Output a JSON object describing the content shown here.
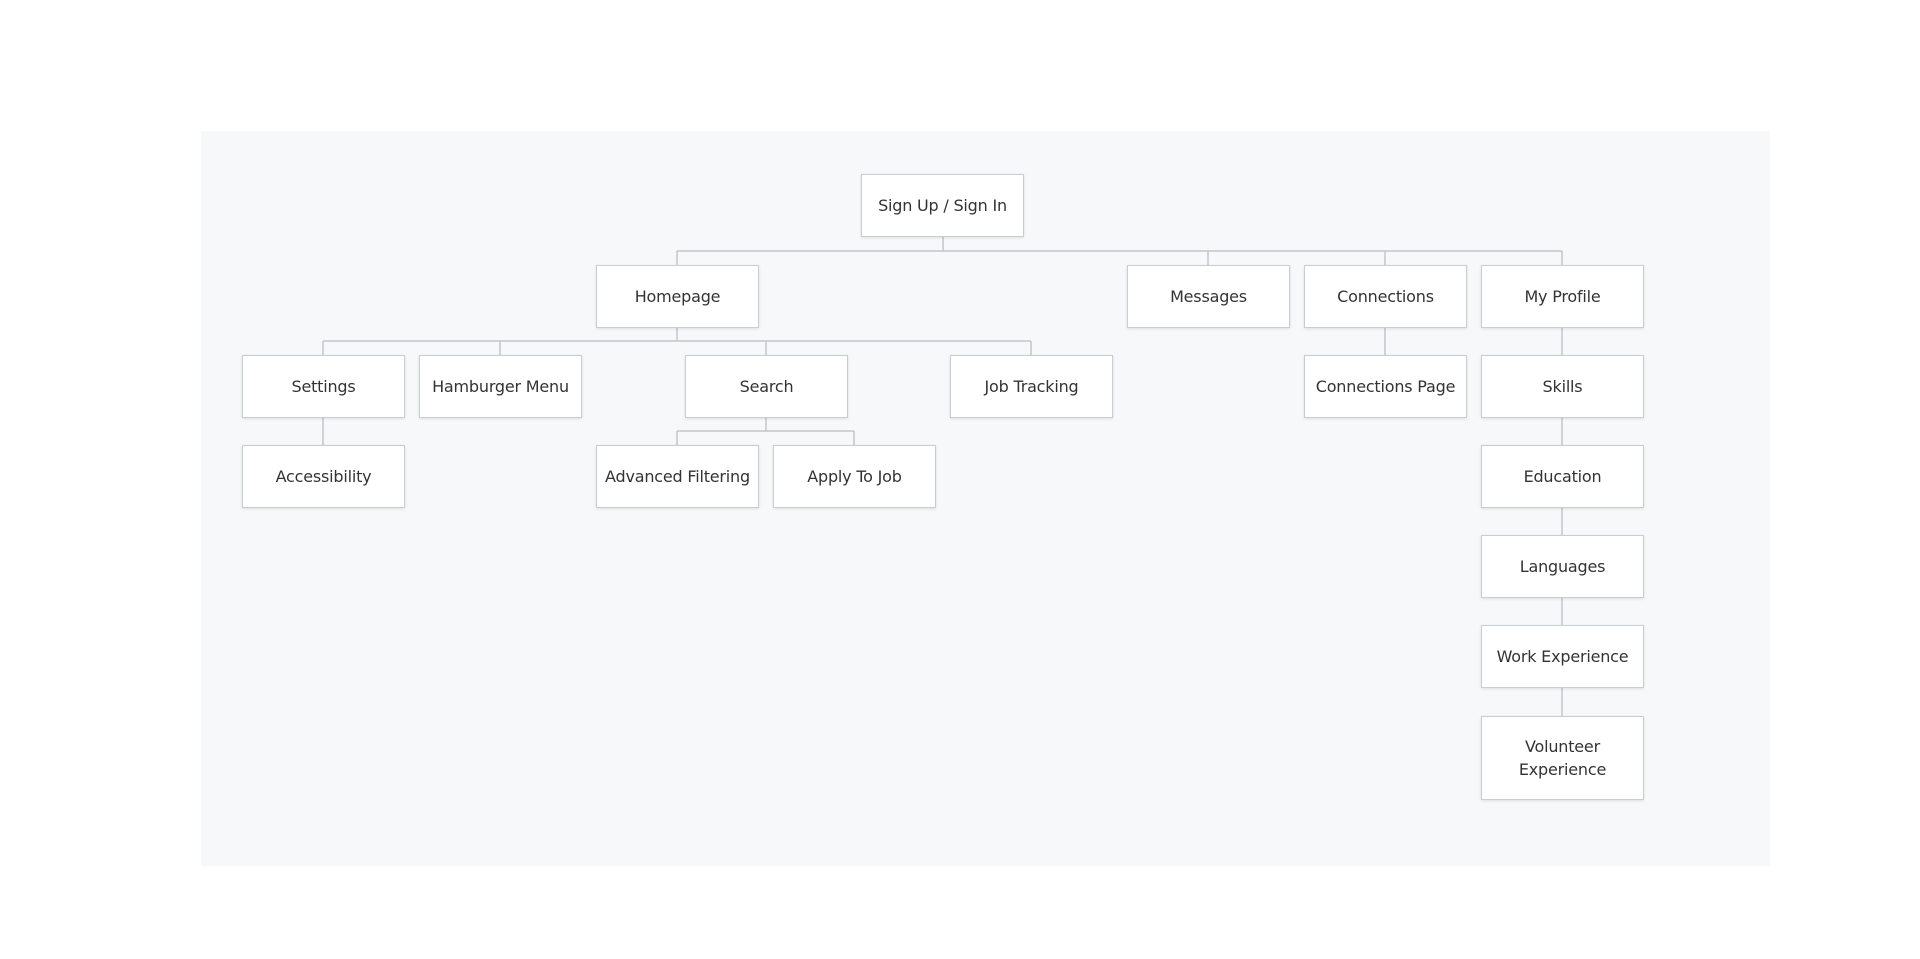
{
  "sitemap": {
    "sign_in": "Sign Up / Sign In",
    "homepage": "Homepage",
    "messages": "Messages",
    "connections": "Connections",
    "my_profile": "My Profile",
    "settings": "Settings",
    "hamburger_menu": "Hamburger Menu",
    "search": "Search",
    "job_tracking": "Job Tracking",
    "connections_page": "Connections Page",
    "skills": "Skills",
    "accessibility": "Accessibility",
    "advanced_filtering": "Advanced Filtering",
    "apply_to_job": "Apply To Job",
    "education": "Education",
    "languages": "Languages",
    "work_experience": "Work Experience",
    "volunteer_experience": "Volunteer\nExperience"
  },
  "colors": {
    "canvas_bg": "#f7f8fa",
    "node_bg": "#ffffff",
    "node_border": "#c9ccd1",
    "connector": "#c3c6cb",
    "text": "#333333"
  }
}
